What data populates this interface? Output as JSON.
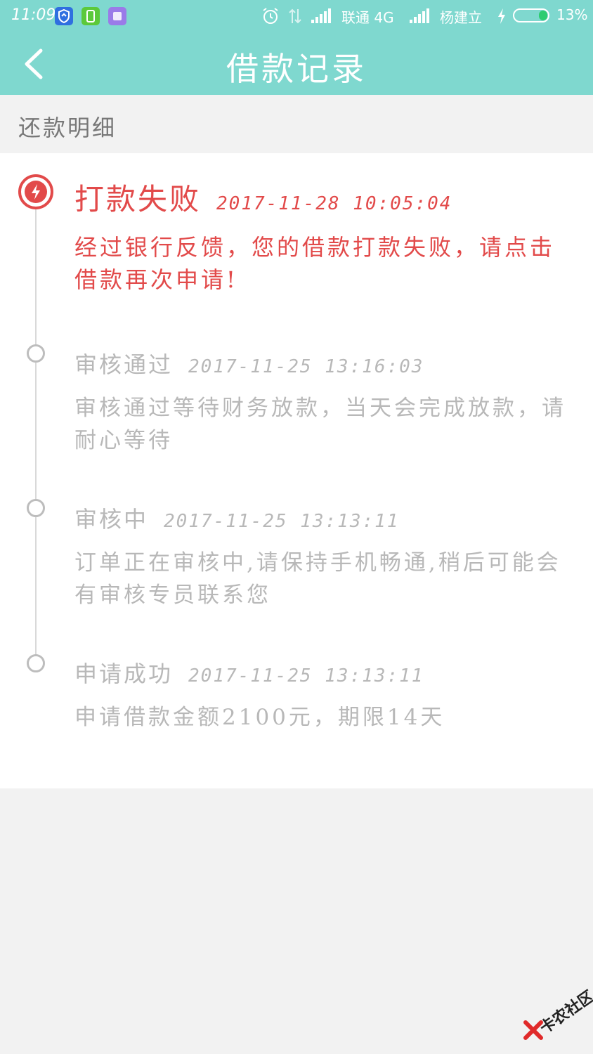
{
  "status_bar": {
    "time": "11:09",
    "carrier1": "联通 4G",
    "carrier2": "杨建立",
    "battery": "13%",
    "battery_level": 0.13,
    "icons": [
      "shield-icon",
      "phone-app-icon",
      "purple-app-icon",
      "alarm-icon",
      "data-arrows-icon",
      "signal-icon",
      "charging-icon",
      "battery-icon"
    ]
  },
  "nav": {
    "title": "借款记录",
    "back_icon": "chevron-left-icon"
  },
  "section": {
    "label": "还款明细"
  },
  "timeline": [
    {
      "status": "打款失败",
      "time": "2017-11-28  10:05:04",
      "desc": "经过银行反馈，您的借款打款失败，请点击借款再次申请!",
      "state": "failed",
      "color": "#e24a4a"
    },
    {
      "status": "审核通过",
      "time": "2017-11-25  13:16:03",
      "desc": "审核通过等待财务放款，当天会完成放款，请耐心等待",
      "state": "done",
      "color": "#b8b8b8"
    },
    {
      "status": "审核中",
      "time": "2017-11-25  13:13:11",
      "desc": "订单正在审核中,请保持手机畅通,稍后可能会有审核专员联系您",
      "state": "done",
      "color": "#b8b8b8"
    },
    {
      "status": "申请成功",
      "time": "2017-11-25  13:13:11",
      "desc": "申请借款金额2100元，期限14天",
      "state": "done",
      "color": "#b8b8b8"
    }
  ],
  "watermark": {
    "text": "卡农社区"
  },
  "colors": {
    "header": "#7fd8cf",
    "accent_red": "#e24a4a",
    "muted_text": "#b8b8b8",
    "page_bg": "#f2f2f2"
  }
}
